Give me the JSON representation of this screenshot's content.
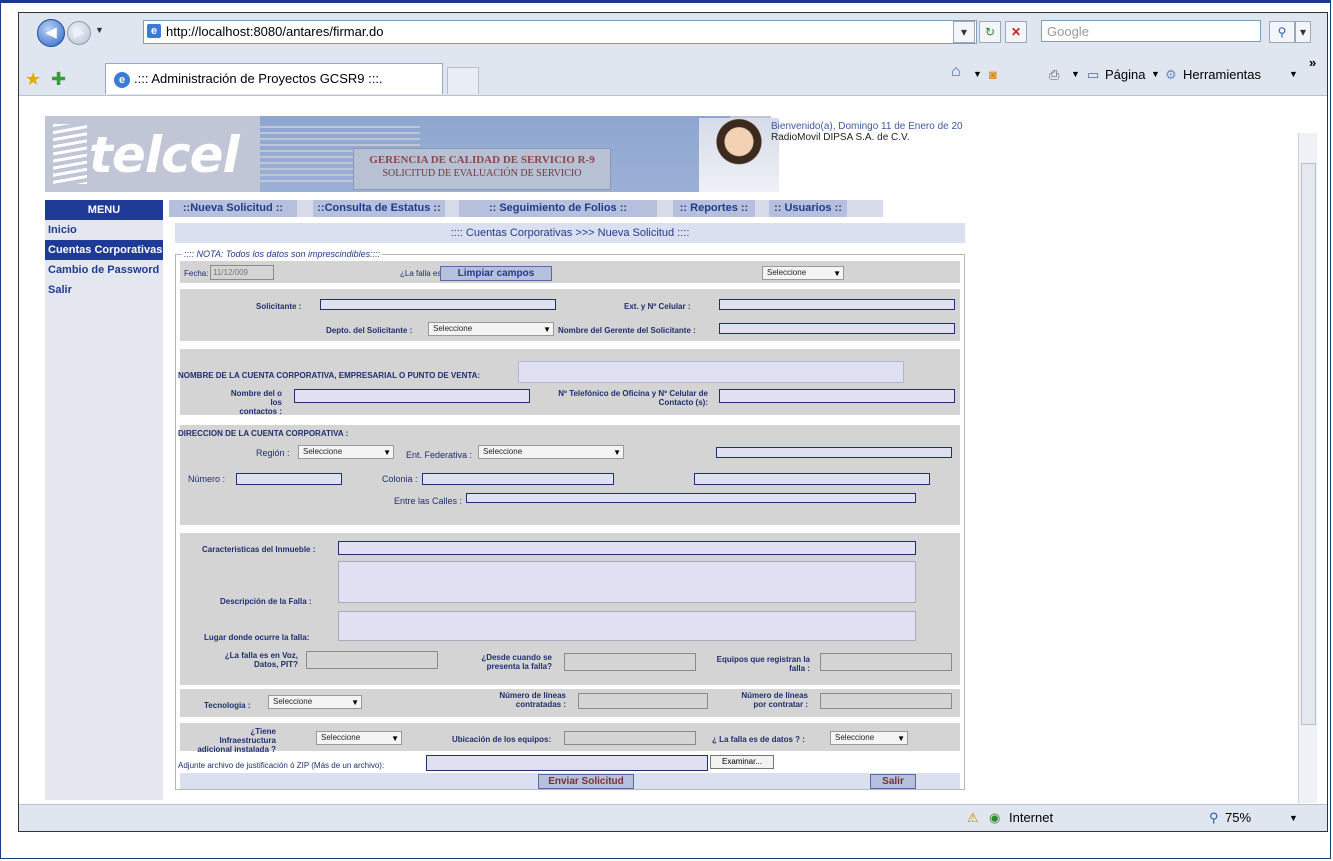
{
  "browser": {
    "url": "http://localhost:8080/antares/firmar.do",
    "search_placeholder": "Google",
    "tab_title": ".::: Administración de Proyectos GCSR9 :::.",
    "tools_page": "Página",
    "tools_tools": "Herramientas",
    "chevrons": "»"
  },
  "banner": {
    "logo": "telcel",
    "line1": "GERENCIA DE CALIDAD DE SERVICIO R-9",
    "line2": "SOLICITUD DE EVALUACIÓN DE SERVICIO",
    "welcome": "Bienvenido(a), Domingo 11 de Enero de 20",
    "company": "RadioMovil DIPSA S.A. de C.V."
  },
  "topmenu": [
    "::Nueva Solicitud ::",
    "::Consulta de Estatus ::",
    ":: Seguimiento de Folios ::",
    ":: Reportes ::",
    ":: Usuarios ::"
  ],
  "sidemenu": {
    "header": "MENU",
    "items": [
      "Inicio",
      "Cuentas Corporativas",
      "Cambio de Password",
      "Salir"
    ]
  },
  "form": {
    "title": ":::: Cuentas Corporativas >>> Nueva Solicitud ::::",
    "legend": ":::: NOTA: Todos los datos son imprescindibles::::",
    "fecha_label": "Fecha:",
    "fecha_value": "11/12/009",
    "falla_label": "¿La falla es c",
    "clear_button": "Limpiar campos",
    "select_default": "Seleccione",
    "solicitante_label": "Solicitante :",
    "ext_label": "Ext. y Nº Celular :",
    "depto_label": "Depto. del Solicitante :",
    "gerente_label": "Nombre del Gerente del Solicitante :",
    "cuenta_label": "NOMBRE DE LA CUENTA CORPORATIVA, EMPRESARIAL O PUNTO DE VENTA:",
    "contactos_label1": "Nombre del o los",
    "contactos_label2": "contactos :",
    "telefono_label1": "Nº Telefónico de Oficina y Nº Celular de",
    "telefono_label2": "Contacto (s):",
    "direccion_label": "DIRECCION DE LA CUENTA CORPORATIVA :",
    "region_label": "Región :",
    "ent_label": "Ent. Federativa :",
    "numero_label": "Número :",
    "colonia_label": "Colonia :",
    "calles_label": "Entre las Calles :",
    "caracteristicas_label": "Caracteristicas del Inmueble :",
    "descripcion_label": "Descripción de la Falla :",
    "lugar_label": "Lugar donde ocurre la falla:",
    "voz_label1": "¿La falla es en Voz,",
    "voz_label2": "Datos, PIT?",
    "desde_label1": "¿Desde cuando se",
    "desde_label2": "presenta la falla?",
    "equipos_label1": "Equipos que registran la",
    "equipos_label2": "falla :",
    "tecnologia_label": "Tecnologia :",
    "lineas_contr_label1": "Número de líneas",
    "lineas_contr_label2": "contratadas :",
    "lineas_por_label1": "Número de líneas",
    "lineas_por_label2": "por contratar :",
    "infra_label1": "¿Tiene Infraestructura",
    "infra_label2": "adicional instalada ?",
    "ubicacion_label": "Ubicación de los equipos:",
    "datos_label": "¿ La falla es de datos ? :",
    "adjunte_label": "Adjunte archivo de justificación ó ZIP (Más de un archivo):",
    "browse_button": "Examinar...",
    "send_button": "Enviar Solicitud",
    "exit_button": "Salir"
  },
  "statusbar": {
    "zone": "Internet",
    "zoom": "75%"
  }
}
